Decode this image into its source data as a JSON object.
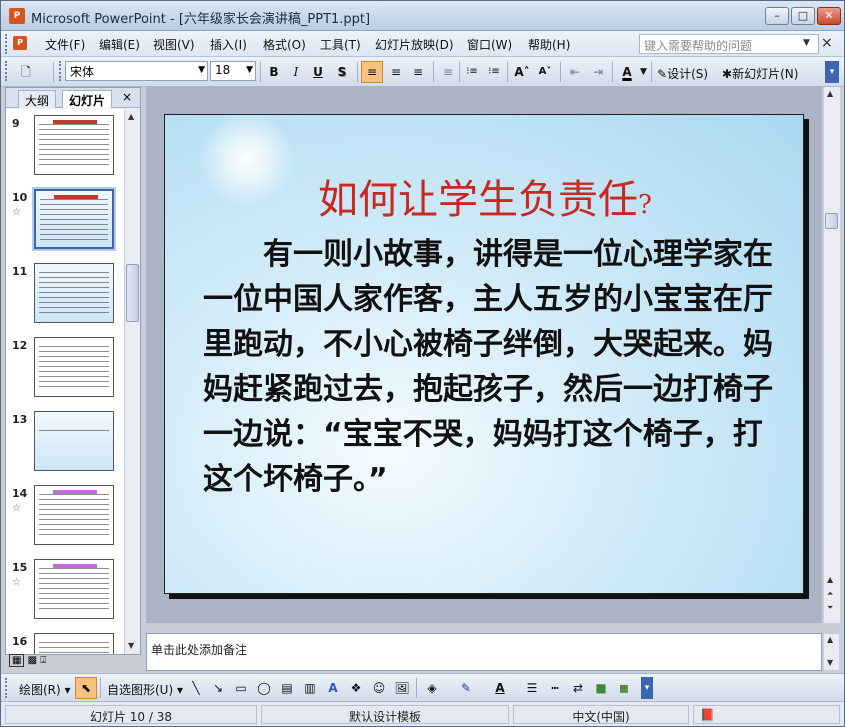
{
  "window": {
    "title": "Microsoft PowerPoint - [六年级家长会演讲稿_PPT1.ppt]",
    "app_icon": "P",
    "controls": {
      "minimize": "–",
      "maximize": "□",
      "close": "✕"
    }
  },
  "menu": {
    "items": [
      "文件(F)",
      "编辑(E)",
      "视图(V)",
      "插入(I)",
      "格式(O)",
      "工具(T)",
      "幻灯片放映(D)",
      "窗口(W)",
      "帮助(H)"
    ],
    "help_placeholder": "键入需要帮助的问题",
    "close_glyph": "×"
  },
  "toolbar": {
    "font_name": "宋体",
    "font_size": "18",
    "bold": "B",
    "italic": "I",
    "underline": "U",
    "shadow": "S",
    "align_left": "≡",
    "align_center": "≡",
    "align_right": "≡",
    "numbering": "⁝≡",
    "bullets": "⁝≡",
    "grow_font": "A˄",
    "shrink_font": "A˅",
    "decrease_indent": "⇤",
    "increase_indent": "⇥",
    "font_color": "A",
    "design_label": "设计(S)",
    "new_slide_label": "新幻灯片(N)"
  },
  "left_pane": {
    "tab_outline": "大纲",
    "tab_slides": "幻灯片",
    "close_glyph": "×",
    "thumbnails": [
      {
        "num": "9",
        "star": ""
      },
      {
        "num": "10",
        "star": "☆"
      },
      {
        "num": "11",
        "star": ""
      },
      {
        "num": "12",
        "star": ""
      },
      {
        "num": "13",
        "star": ""
      },
      {
        "num": "14",
        "star": "☆"
      },
      {
        "num": "15",
        "star": "☆"
      },
      {
        "num": "16",
        "star": ""
      }
    ]
  },
  "slide": {
    "title": "如何让学生负责任",
    "title_mark": "?",
    "body": "　　有一则小故事，讲得是一位心理学家在一位中国人家作客，主人五岁的小宝宝在厅里跑动，不小心被椅子绊倒，大哭起来。妈妈赶紧跑过去，抱起孩子，然后一边打椅子一边说：“宝宝不哭，妈妈打这个椅子，打这个坏椅子。”"
  },
  "notes": {
    "placeholder": "单击此处添加备注"
  },
  "drawbar": {
    "draw_label": "绘图(R)",
    "autoshapes_label": "自选图形(U)"
  },
  "status": {
    "slide_info": "幻灯片 10 / 38",
    "template": "默认设计模板",
    "language": "中文(中国)"
  },
  "colors": {
    "title_red": "#c8281f",
    "accent_blue": "#3a66b0"
  }
}
